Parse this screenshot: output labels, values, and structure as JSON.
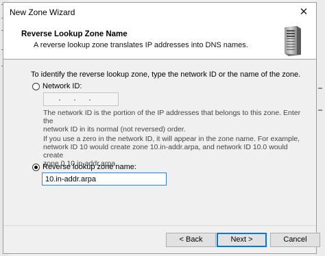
{
  "window": {
    "title": "New Zone Wizard",
    "close_glyph": "✕"
  },
  "header": {
    "title": "Reverse Lookup Zone Name",
    "subtitle": "A reverse lookup zone translates IP addresses into DNS names.",
    "icon": "server-icon"
  },
  "body": {
    "intro": "To identify the reverse lookup zone, type the network ID or the name of the zone.",
    "network_id_option": {
      "label": "Network ID:",
      "selected": false
    },
    "network_id_desc_line1": "The network ID is the portion of the IP addresses that belongs to this zone. Enter the",
    "network_id_desc_line2": "network ID in its normal (not reversed) order.",
    "zero_note_line1": "If you use a zero in the network ID, it will appear in the zone name. For example,",
    "zero_note_line2": "network ID 10 would create zone 10.in-addr.arpa, and network ID 10.0 would create",
    "zero_note_line3": "zone 0.10.in-addr.arpa.",
    "zone_name_option": {
      "label": "Reverse lookup zone name:",
      "selected": true
    },
    "zone_name_value": "10.in-addr.arpa"
  },
  "buttons": {
    "back": "< Back",
    "next": "Next >",
    "cancel": "Cancel"
  }
}
